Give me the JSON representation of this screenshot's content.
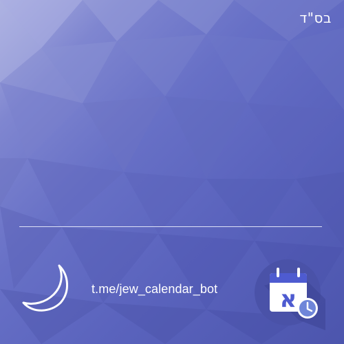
{
  "header": {
    "blessing": "בס\"ד"
  },
  "footer": {
    "link": "t.me/jew_calendar_bot",
    "moon_icon": "crescent-moon-icon",
    "app_icon": "calendar-clock-icon",
    "app_icon_letter": "א"
  },
  "colors": {
    "background_top_left": "#a9aee0",
    "background_bottom_right": "#4c55ad",
    "text": "#ffffff",
    "badge_circle": "#4a52a8",
    "calendar_header": "#4e5bd0",
    "calendar_body": "#ffffff",
    "clock_face": "#6f86d9"
  }
}
